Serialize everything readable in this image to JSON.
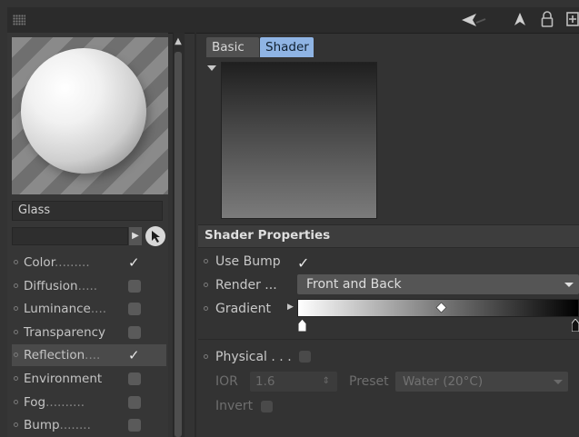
{
  "material": {
    "name": "Glass",
    "channels": [
      {
        "label": "Color",
        "dots": ".........",
        "checked": true
      },
      {
        "label": "Diffusion",
        "dots": ".....",
        "checked": false
      },
      {
        "label": "Luminance",
        "dots": "....",
        "checked": false
      },
      {
        "label": "Transparency",
        "dots": "",
        "checked": false
      },
      {
        "label": "Reflection",
        "dots": "....",
        "checked": true,
        "selected": true
      },
      {
        "label": "Environment",
        "dots": "",
        "checked": false
      },
      {
        "label": "Fog",
        "dots": "..........",
        "checked": false
      },
      {
        "label": "Bump",
        "dots": "........",
        "checked": false
      }
    ]
  },
  "tabs": {
    "basic": "Basic",
    "shader": "Shader",
    "active": "Shader"
  },
  "shader_properties": {
    "title": "Shader Properties",
    "use_bump_label": "Use Bump",
    "use_bump_checked": true,
    "render_label": "Render ...",
    "render_value": "Front and Back",
    "gradient_label": "Gradient",
    "physical_label": "Physical . . .",
    "physical_checked": false,
    "ior_label": "IOR",
    "ior_value": "1.6",
    "preset_label": "Preset",
    "preset_value": "Water (20°C)",
    "invert_label": "Invert",
    "invert_checked": false
  },
  "icons": {
    "checkmark": "✓",
    "stepper": "⇕",
    "pick": "arrow-pointer-icon"
  },
  "colors": {
    "active_tab": "#8fb4e4",
    "panel_bg": "#333333"
  }
}
